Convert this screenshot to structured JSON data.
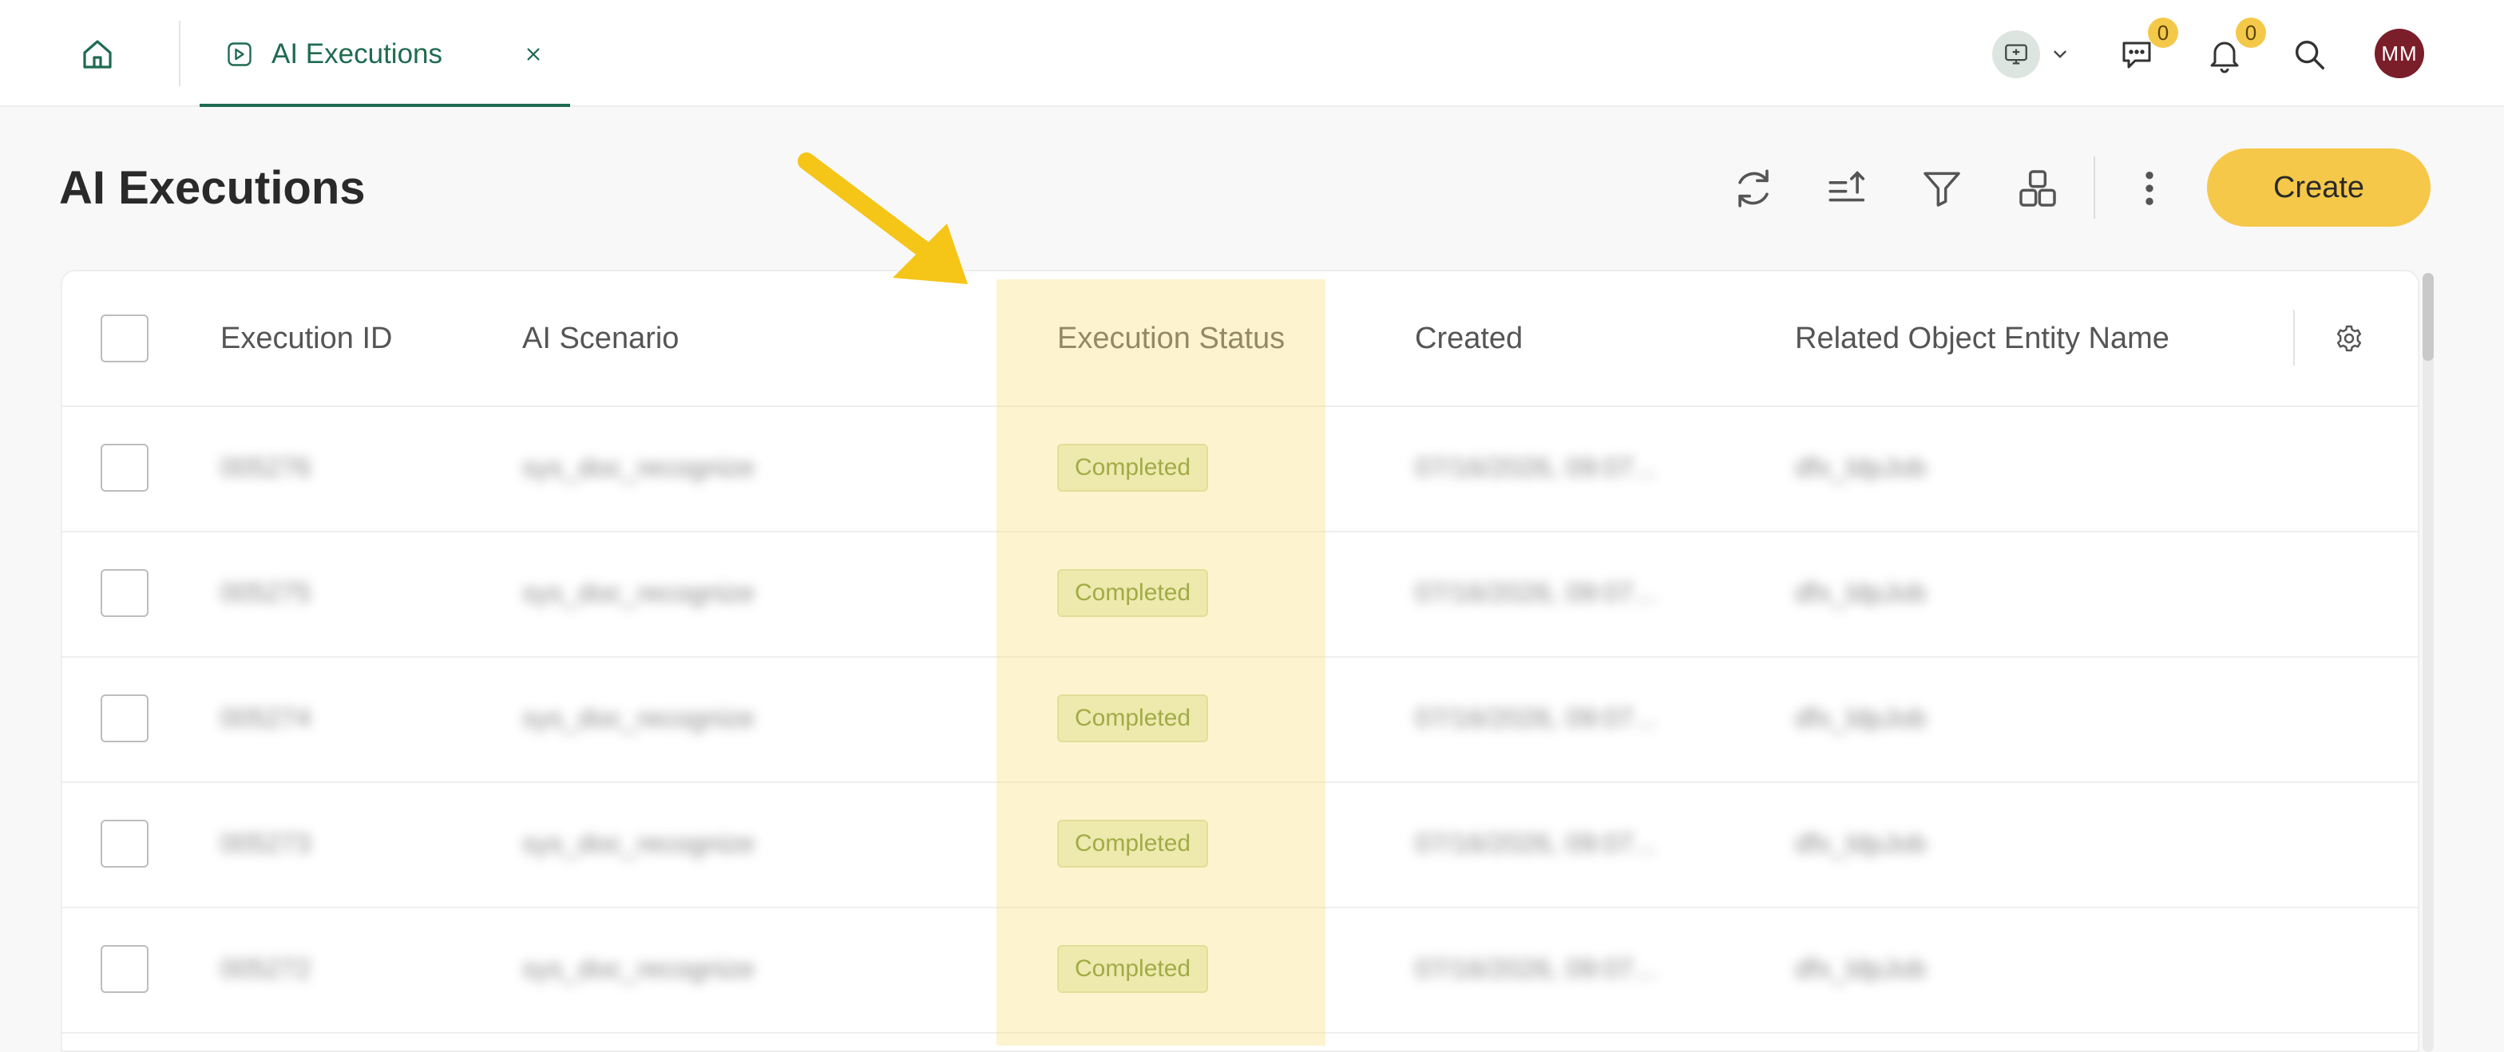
{
  "header": {
    "tab_title": "AI Executions",
    "chat_count": "0",
    "notification_count": "0",
    "avatar_initials": "MM"
  },
  "page": {
    "title": "AI Executions",
    "create_label": "Create"
  },
  "table": {
    "columns": [
      "Execution ID",
      "AI Scenario",
      "Execution Status",
      "Created",
      "Related Object Entity Name"
    ],
    "rows": [
      {
        "id": "005276",
        "scenario": "sys_doc_recognize",
        "status": "Completed",
        "created": "07/16/2026, 09:07...",
        "entity": "dfx_ldpJob"
      },
      {
        "id": "005275",
        "scenario": "sys_doc_recognize",
        "status": "Completed",
        "created": "07/16/2026, 09:07...",
        "entity": "dfx_ldpJob"
      },
      {
        "id": "005274",
        "scenario": "sys_doc_recognize",
        "status": "Completed",
        "created": "07/16/2026, 09:07...",
        "entity": "dfx_ldpJob"
      },
      {
        "id": "005273",
        "scenario": "sys_doc_recognize",
        "status": "Completed",
        "created": "07/16/2026, 09:07...",
        "entity": "dfx_ldpJob"
      },
      {
        "id": "005272",
        "scenario": "sys_doc_recognize",
        "status": "Completed",
        "created": "07/16/2026, 09:07...",
        "entity": "dfx_ldpJob"
      }
    ]
  },
  "colors": {
    "accent": "#1f6b4f",
    "create_button": "#f6c84a",
    "highlight": "#fbe280",
    "status_text": "#6b8a24",
    "annotation_arrow": "#f5c518"
  }
}
